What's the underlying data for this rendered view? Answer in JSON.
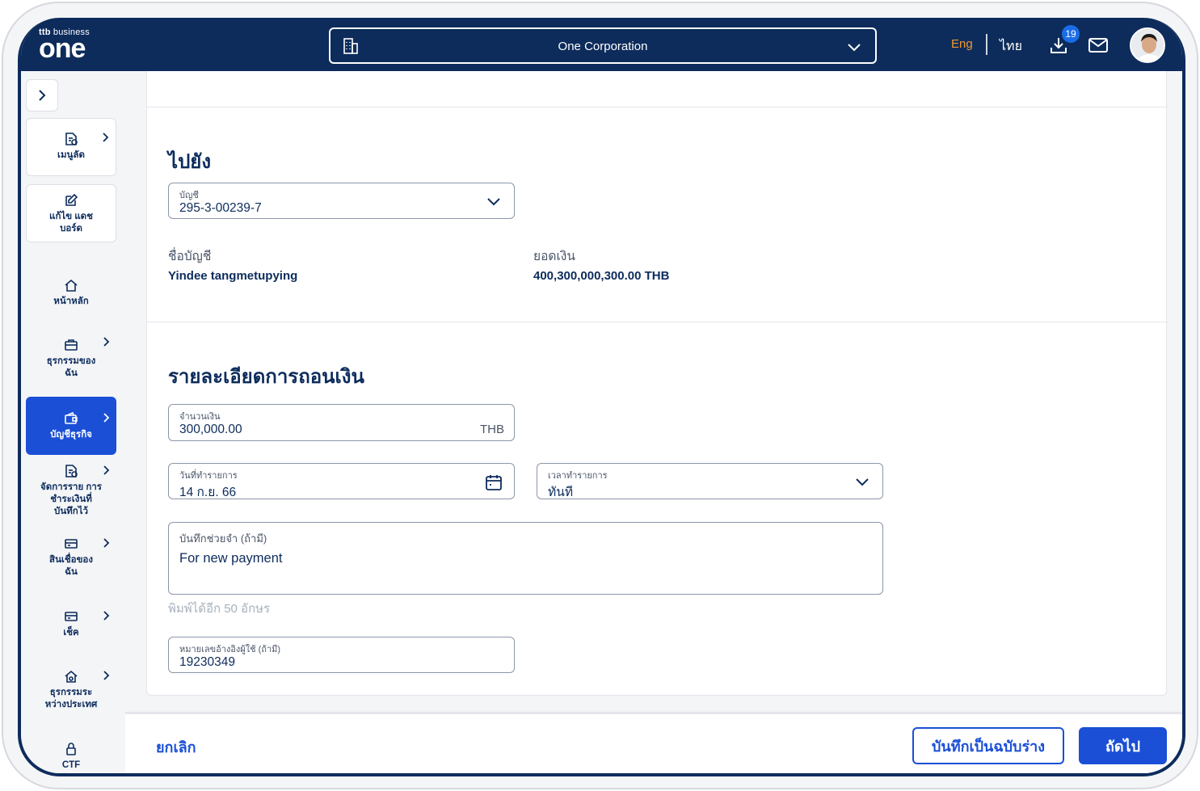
{
  "header": {
    "brand_small": "business",
    "brand_prefix": "ttb",
    "brand_main": "one",
    "company": "One Corporation",
    "lang_en": "Eng",
    "lang_th": "ไทย",
    "download_badge": "19",
    "accent_color": "#f39a2d",
    "primary_color": "#0d2c5c"
  },
  "sidebar": {
    "items": [
      {
        "label": "เมนูลัด",
        "icon": "shortcut-icon",
        "has_arrow": true
      },
      {
        "label": "แก้ไข แดชบอร์ด",
        "icon": "edit-icon",
        "has_arrow": false
      },
      {
        "label": "หน้าหลัก",
        "icon": "home-icon",
        "has_arrow": false
      },
      {
        "label": "ธุรกรรมของ ฉัน",
        "icon": "briefcase-icon",
        "has_arrow": true
      },
      {
        "label": "บัญชีธุรกิจ",
        "icon": "wallet-icon",
        "has_arrow": true,
        "active": true
      },
      {
        "label": "จัดการราย การชำระเงินที่ บันทึกไว้",
        "icon": "document-icon",
        "has_arrow": true
      },
      {
        "label": "สินเชื่อของ ฉัน",
        "icon": "card-icon",
        "has_arrow": true
      },
      {
        "label": "เช็ค",
        "icon": "cheque-icon",
        "has_arrow": true
      },
      {
        "label": "ธุรกรรมระ หว่างประเทศ",
        "icon": "global-icon",
        "has_arrow": true
      },
      {
        "label": "CTF",
        "icon": "lock-icon",
        "has_arrow": false
      }
    ]
  },
  "to_section": {
    "title": "ไปยัง",
    "account_label": "บัญชี",
    "account_value": "295-3-00239-7",
    "name_label": "ชื่อบัญชี",
    "name_value": "Yindee tangmetupying",
    "balance_label": "ยอดเงิน",
    "balance_value": "400,300,000,300.00 THB"
  },
  "details_section": {
    "title": "รายละเอียดการถอนเงิน",
    "amount_label": "จำนวนเงิน",
    "amount_value": "300,000.00",
    "amount_currency": "THB",
    "date_label": "วันที่ทำรายการ",
    "date_value": "14 ก.ย. 66",
    "time_label": "เวลาทำรายการ",
    "time_value": "ทันที",
    "memo_label": "บันทึกช่วยจำ (ถ้ามี)",
    "memo_value": "For new payment",
    "memo_hint": "พิมพ์ได้อีก 50 อักษร",
    "ref_label": "หมายเลขอ้างอิงผู้ใช้ (ถ้ามี)",
    "ref_value": "19230349"
  },
  "footer": {
    "cancel": "ยกเลิก",
    "save_draft": "บันทึกเป็นฉบับร่าง",
    "next": "ถัดไป"
  }
}
